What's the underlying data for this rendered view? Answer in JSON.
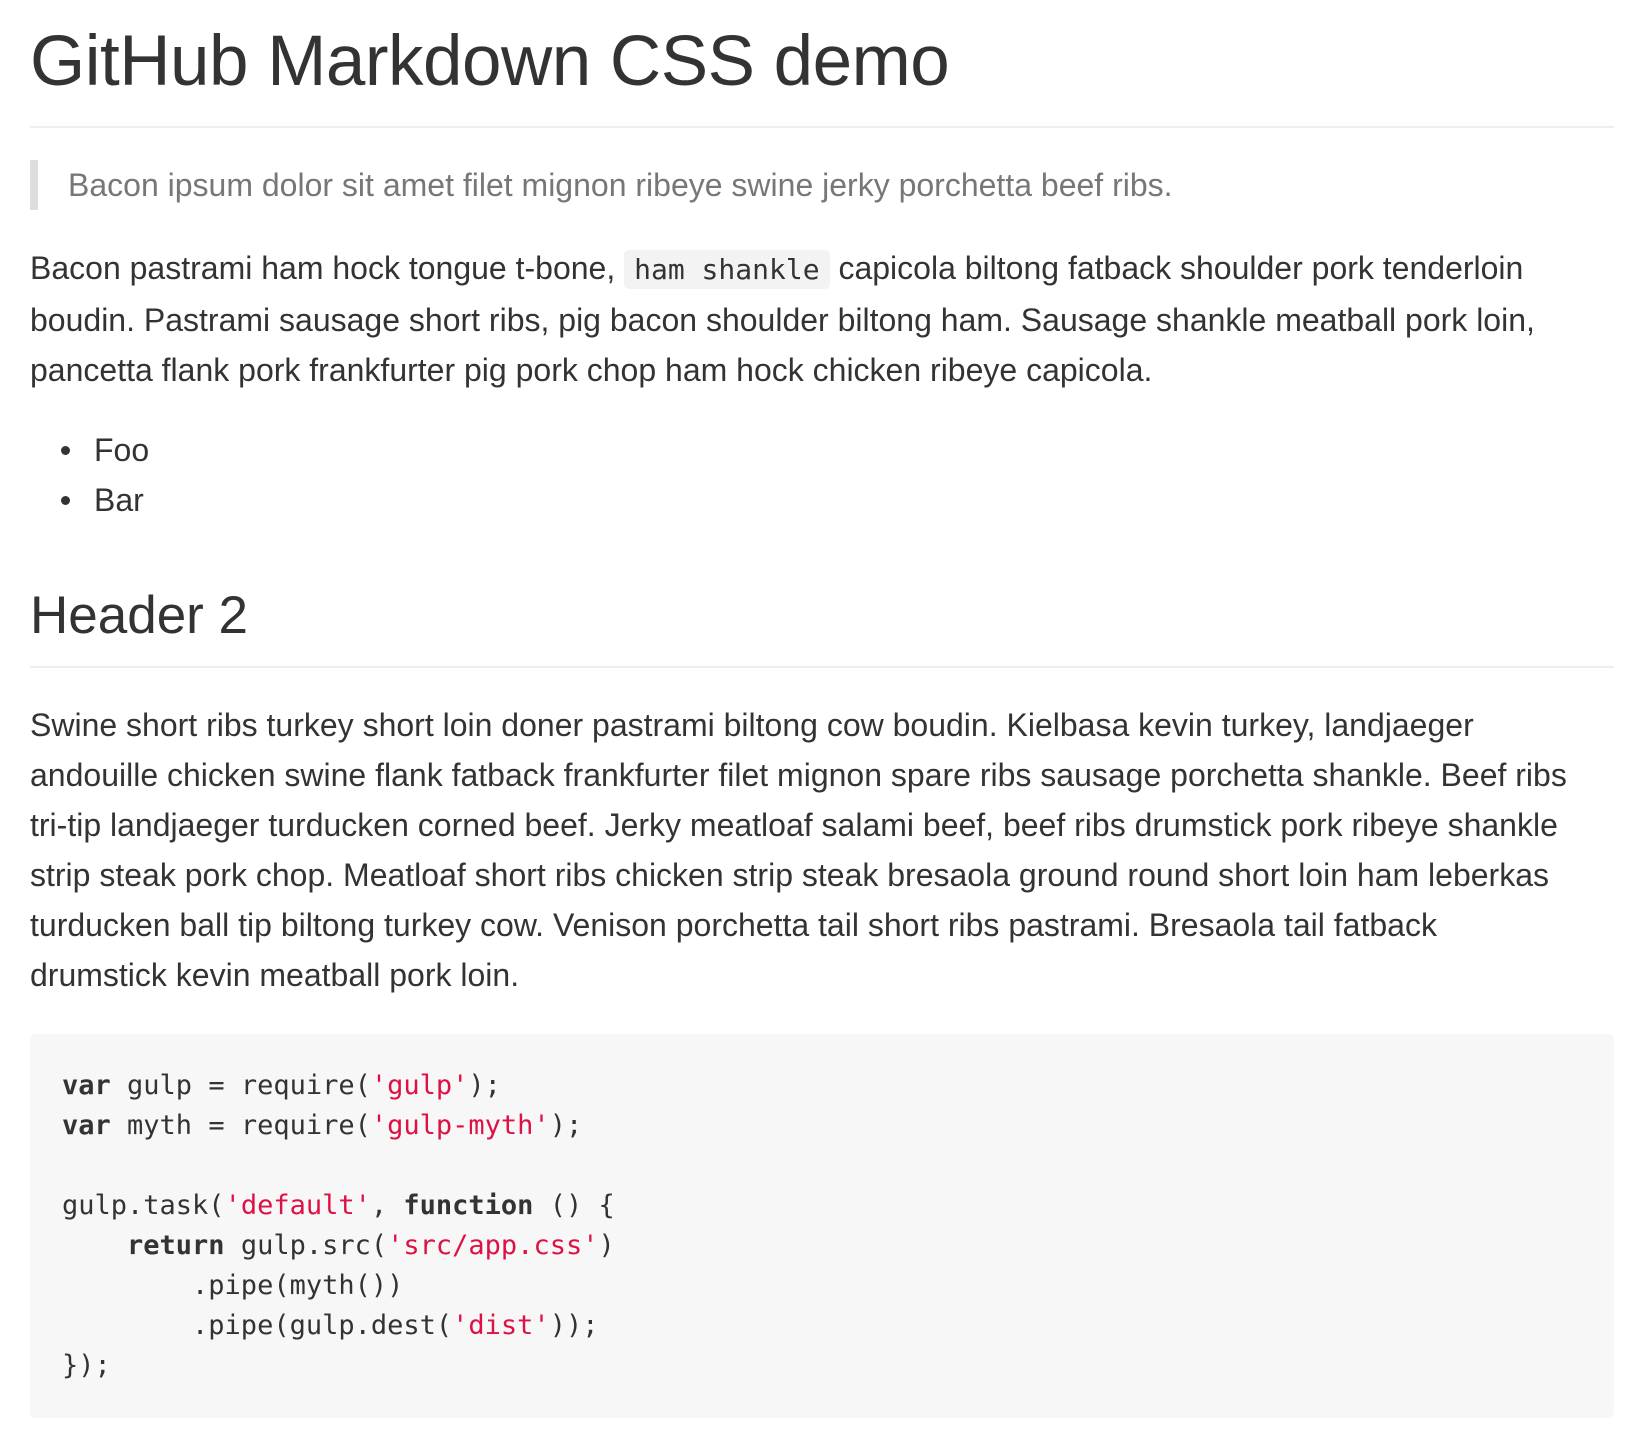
{
  "heading1": "GitHub Markdown CSS demo",
  "blockquote": "Bacon ipsum dolor sit amet filet mignon ribeye swine jerky porchetta beef ribs.",
  "paragraph1": {
    "before_code": "Bacon pastrami ham hock tongue t-bone, ",
    "inline_code": "ham shankle",
    "after_code": " capicola biltong fatback shoulder pork tenderloin",
    "line2": "boudin. Pastrami sausage short ribs, pig bacon shoulder biltong ham. Sausage shankle meatball pork loin,",
    "line3": "pancetta flank pork frankfurter pig pork chop ham hock chicken ribeye capicola."
  },
  "list": [
    "Foo",
    "Bar"
  ],
  "heading2": "Header 2",
  "paragraph2": [
    "Swine short ribs turkey short loin doner pastrami biltong cow boudin. Kielbasa kevin turkey, landjaeger",
    "andouille chicken swine flank fatback frankfurter filet mignon spare ribs sausage porchetta shankle. Beef ribs",
    "tri-tip landjaeger turducken corned beef. Jerky meatloaf salami beef, beef ribs drumstick pork ribeye shankle",
    "strip steak pork chop. Meatloaf short ribs chicken strip steak bresaola ground round short loin ham leberkas",
    "turducken ball tip biltong turkey cow. Venison porchetta tail short ribs pastrami. Bresaola tail fatback",
    "drumstick kevin meatball pork loin."
  ],
  "code": {
    "line1": {
      "kw": "var",
      "text1": " gulp = require(",
      "str": "'gulp'",
      "text2": ");"
    },
    "line2": {
      "kw": "var",
      "text1": " myth = require(",
      "str": "'gulp-myth'",
      "text2": ");"
    },
    "line4": {
      "text1": "gulp.task(",
      "str": "'default'",
      "text2": ", ",
      "kw": "function",
      "text3": " () {"
    },
    "line5": {
      "indent": "    ",
      "kw": "return",
      "text1": " gulp.src(",
      "str": "'src/app.css'",
      "text2": ")"
    },
    "line6": {
      "text": "        .pipe(myth())"
    },
    "line7": {
      "text1": "        .pipe(gulp.dest(",
      "str": "'dist'",
      "text2": "));"
    },
    "line8": {
      "text": "});"
    }
  },
  "colors": {
    "text": "#333333",
    "blockquote_text": "#777777",
    "blockquote_border": "#dddddd",
    "rule": "#eeeeee",
    "code_background": "#f7f7f7",
    "code_string": "#dd1144"
  }
}
